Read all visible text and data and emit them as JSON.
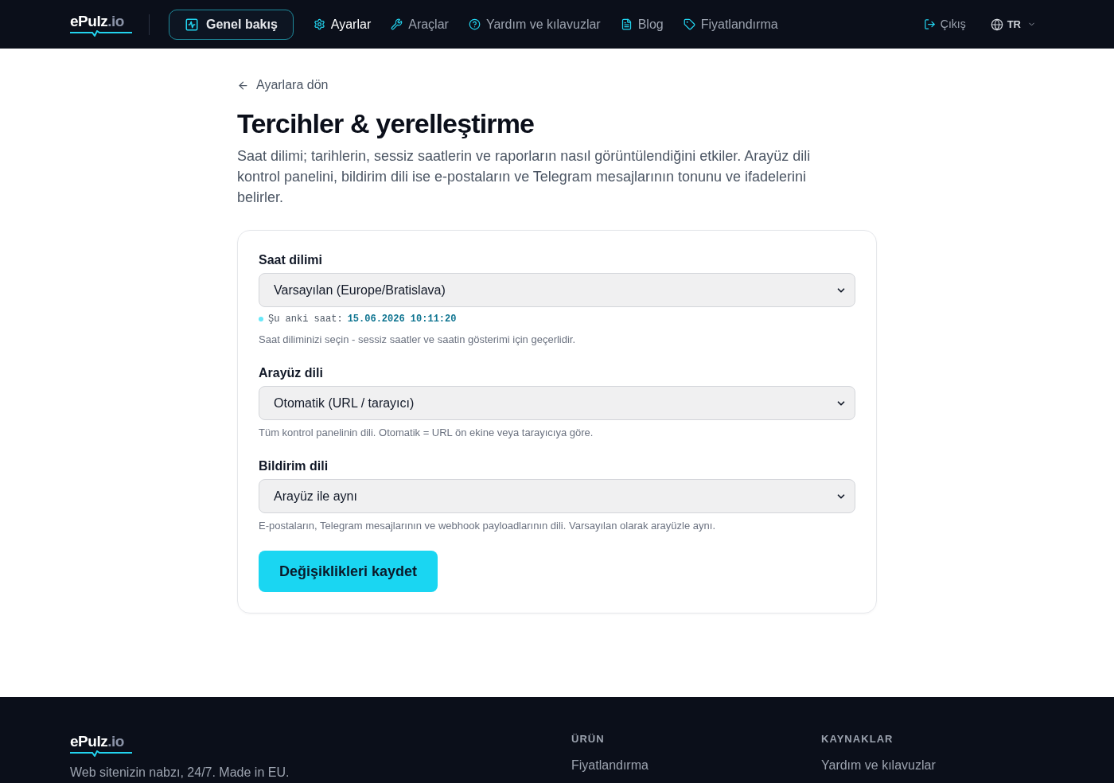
{
  "header": {
    "logo": {
      "name": "ePulz",
      "suffix": ".io"
    },
    "nav": [
      {
        "label": "Genel bakış",
        "kind": "button",
        "selected": false
      },
      {
        "label": "Ayarlar",
        "kind": "link",
        "selected": true
      },
      {
        "label": "Araçlar",
        "kind": "link",
        "selected": false
      },
      {
        "label": "Yardım ve kılavuzlar",
        "kind": "link",
        "selected": false
      },
      {
        "label": "Blog",
        "kind": "link",
        "selected": false
      },
      {
        "label": "Fiyatlandırma",
        "kind": "link",
        "selected": false
      }
    ],
    "logout": {
      "label": "Çıkış"
    },
    "language": {
      "label": "TR"
    }
  },
  "back_link": {
    "label": "Ayarlara dön"
  },
  "title": "Tercihler & yerelleştirme",
  "description": "Saat dilimi; tarihlerin, sessiz saatlerin ve raporların nasıl görüntülendiğini etkiler. Arayüz dili kontrol panelini, bildirim dili ise e-postaların ve Telegram mesajlarının tonunu ve ifadelerini belirler.",
  "form": {
    "fields": [
      {
        "label": "Saat dilimi",
        "value": "Varsayılan (Europe/Bratislava)",
        "current_time": {
          "label": "Şu anki saat:",
          "value": "15.06.2026 10:11:20"
        },
        "hint": "Saat diliminizi seçin - sessiz saatler ve saatin gösterimi için geçerlidir."
      },
      {
        "label": "Arayüz dili",
        "value": "Otomatik (URL / tarayıcı)",
        "hint": "Tüm kontrol panelinin dili. Otomatik = URL ön ekine veya tarayıcıya göre."
      },
      {
        "label": "Bildirim dili",
        "value": "Arayüz ile aynı",
        "hint": "E-postaların, Telegram mesajlarının ve webhook payloadlarının dili. Varsayılan olarak arayüzle aynı."
      }
    ],
    "save_button": "Değişiklikleri kaydet"
  },
  "footer": {
    "logo": {
      "name": "ePulz",
      "suffix": ".io"
    },
    "tagline": "Web sitenizin nabzı, 24/7. Made in EU.",
    "columns": [
      {
        "heading": "ÜRÜN",
        "links": [
          "Fiyatlandırma"
        ]
      },
      {
        "heading": "KAYNAKLAR",
        "links": [
          "Yardım ve kılavuzlar"
        ]
      }
    ]
  }
}
